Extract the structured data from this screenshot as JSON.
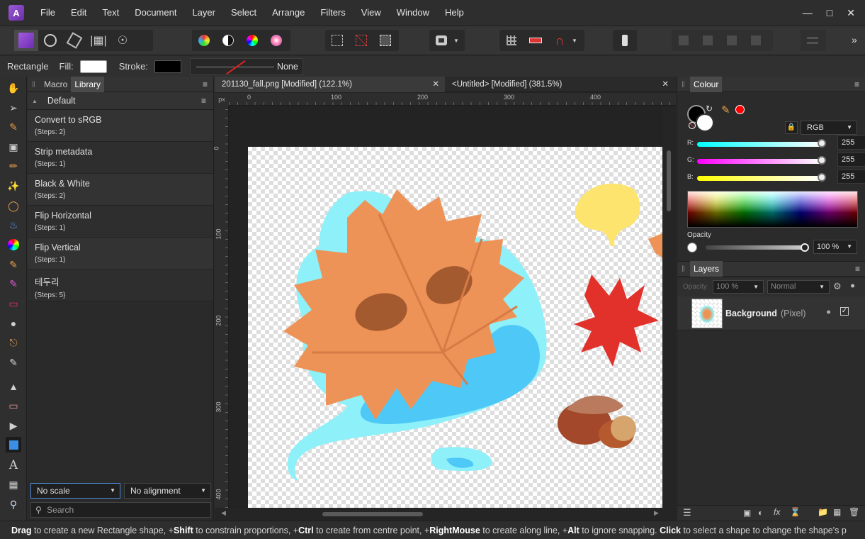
{
  "app": {
    "name": "Affinity Photo"
  },
  "menu": [
    "File",
    "Edit",
    "Text",
    "Document",
    "Layer",
    "Select",
    "Arrange",
    "Filters",
    "View",
    "Window",
    "Help"
  ],
  "context": {
    "tool_name": "Rectangle",
    "fill_label": "Fill:",
    "stroke_label": "Stroke:",
    "stroke_width": "None"
  },
  "library": {
    "tabs": [
      "Macro",
      "Library"
    ],
    "category": "Default",
    "macros": [
      {
        "title": "Convert to sRGB",
        "steps": "{Steps: 2}"
      },
      {
        "title": "Strip metadata",
        "steps": "{Steps: 1}"
      },
      {
        "title": "Black & White",
        "steps": "{Steps: 2}"
      },
      {
        "title": "Flip Horizontal",
        "steps": "{Steps: 1}"
      },
      {
        "title": "Flip Vertical",
        "steps": "{Steps: 1}"
      },
      {
        "title": "테두리",
        "steps": "{Steps: 5}"
      }
    ],
    "scale": "No scale",
    "alignment": "No alignment",
    "search_placeholder": "Search"
  },
  "documents": [
    {
      "title": "201130_fall.png [Modified] (122.1%)"
    },
    {
      "title": "<Untitled> [Modified] (381.5%)"
    }
  ],
  "ruler": {
    "unit": "px",
    "h_ticks": [
      "0",
      "100",
      "200",
      "300",
      "400"
    ],
    "v_ticks": [
      "0",
      "100",
      "200",
      "300",
      "400"
    ]
  },
  "colour": {
    "tab": "Colour",
    "model": "RGB",
    "r_label": "R:",
    "g_label": "G:",
    "b_label": "B:",
    "r": "255",
    "g": "255",
    "b": "255",
    "opacity_label": "Opacity",
    "opacity": "100 %",
    "fill_color": "#000000",
    "stroke_color": "#ffffff",
    "recent_color": "#ff0000"
  },
  "layers": {
    "tab": "Layers",
    "opacity_label": "Opacity",
    "opacity": "100 %",
    "blend": "Normal",
    "items": [
      {
        "name": "Background",
        "kind": "(Pixel)"
      }
    ]
  },
  "status": {
    "segments": [
      {
        "b": "Drag",
        "t": " to create a new Rectangle shape, +"
      },
      {
        "b": "Shift",
        "t": " to constrain proportions, +"
      },
      {
        "b": "Ctrl",
        "t": " to create from centre point, +"
      },
      {
        "b": "RightMouse",
        "t": " to create along line, +"
      },
      {
        "b": "Alt",
        "t": " to ignore snapping. "
      },
      {
        "b": "Click",
        "t": " to select a shape to change the shape's p"
      }
    ]
  }
}
